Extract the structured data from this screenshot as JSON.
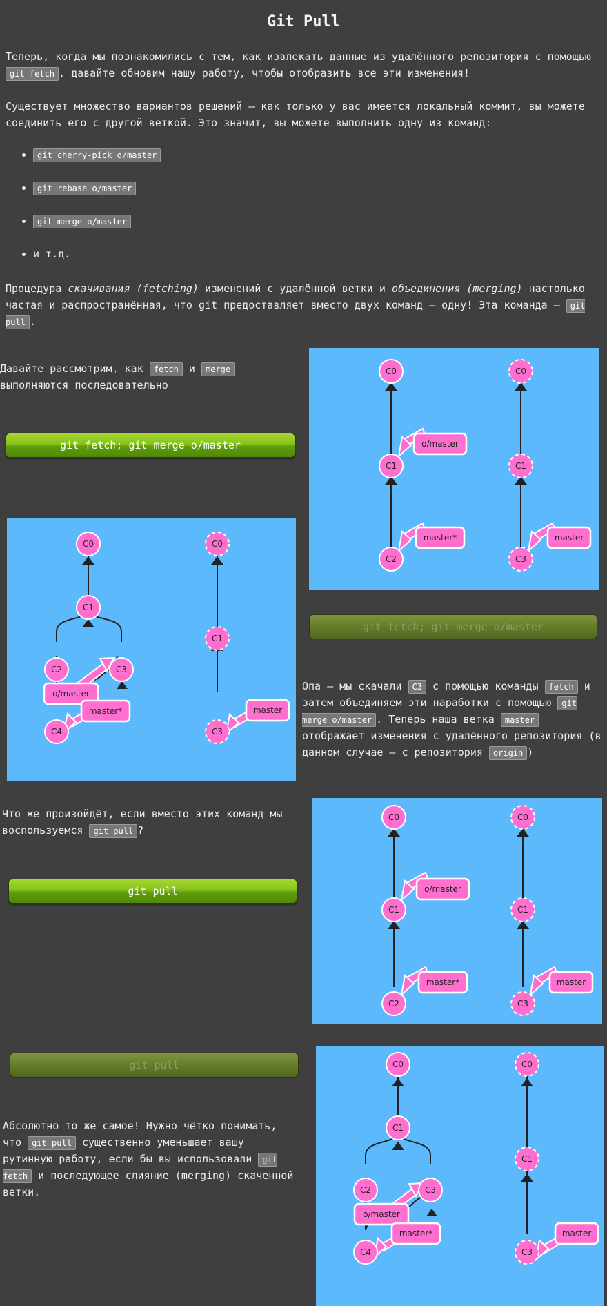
{
  "title": "Git Pull",
  "intro": {
    "p1_a": "Теперь, когда мы познакомились с тем, как извлекать данные из удалённого репозитория с помощью ",
    "p1_code": "git fetch",
    "p1_b": ", давайте обновим нашу работу, чтобы отобразить все эти изменения!",
    "p2": "Существует множество вариантов решений – как только у вас имеется локальный коммит, вы можете соединить его с другой веткой. Это значит, вы можете выполнить одну из команд:",
    "commands": [
      "git cherry-pick o/master",
      "git rebase o/master",
      "git merge o/master"
    ],
    "etc": "и т.д.",
    "p3_a": "Процедура ",
    "p3_em1": "скачивания (fetching)",
    "p3_b": " изменений с удалённой ветки и ",
    "p3_em2": "объединения (merging)",
    "p3_c": " настолько частая и распространённая, что git предоставляет вместо двух команд – одну! Эта команда – ",
    "p3_code": "git pull",
    "p3_d": "."
  },
  "section1": {
    "text_a": "Давайте рассмотрим, как ",
    "code1": "fetch",
    "text_b": " и ",
    "code2": "merge",
    "text_c": " выполняются последовательно",
    "button": "git fetch; git merge o/master"
  },
  "section2": {
    "button": "git fetch; git merge o/master",
    "text_a": "Опа – мы скачали ",
    "code1": "C3",
    "text_b": " с помощью команды ",
    "code2": "fetch",
    "text_c": " и затем объединяем эти наработки с помощью ",
    "code3": "git merge o/master",
    "text_d": ". Теперь наша ветка ",
    "code4": "master",
    "text_e": " отображает изменения с удалённого репозитория (в данном случае — с репозитория ",
    "code5": "origin",
    "text_f": ")"
  },
  "section3": {
    "text_a": "Что же произойдёт, если вместо этих команд мы воспользуемся ",
    "code1": "git pull",
    "text_b": "?",
    "button": "git pull"
  },
  "section4": {
    "button": "git pull",
    "text_a": "Абсолютно то же самое! Нужно чётко понимать, что ",
    "code1": "git pull",
    "text_b": " существенно уменьшает вашу рутинную работу, если бы вы использовали ",
    "code2": "git fetch",
    "text_c": " и последующее слияние (merging) скаченной ветки."
  },
  "labels": {
    "c0": "C0",
    "c1": "C1",
    "c2": "C2",
    "c3": "C3",
    "c4": "C4",
    "omaster": "o/master",
    "master_star": "master*",
    "master": "master"
  },
  "colors": {
    "background": "#3f3f3f",
    "viz_bg": "#5cb9fb",
    "commit": "#ff6fd0",
    "button_green": "#86c21a",
    "code_bg": "#777777"
  }
}
